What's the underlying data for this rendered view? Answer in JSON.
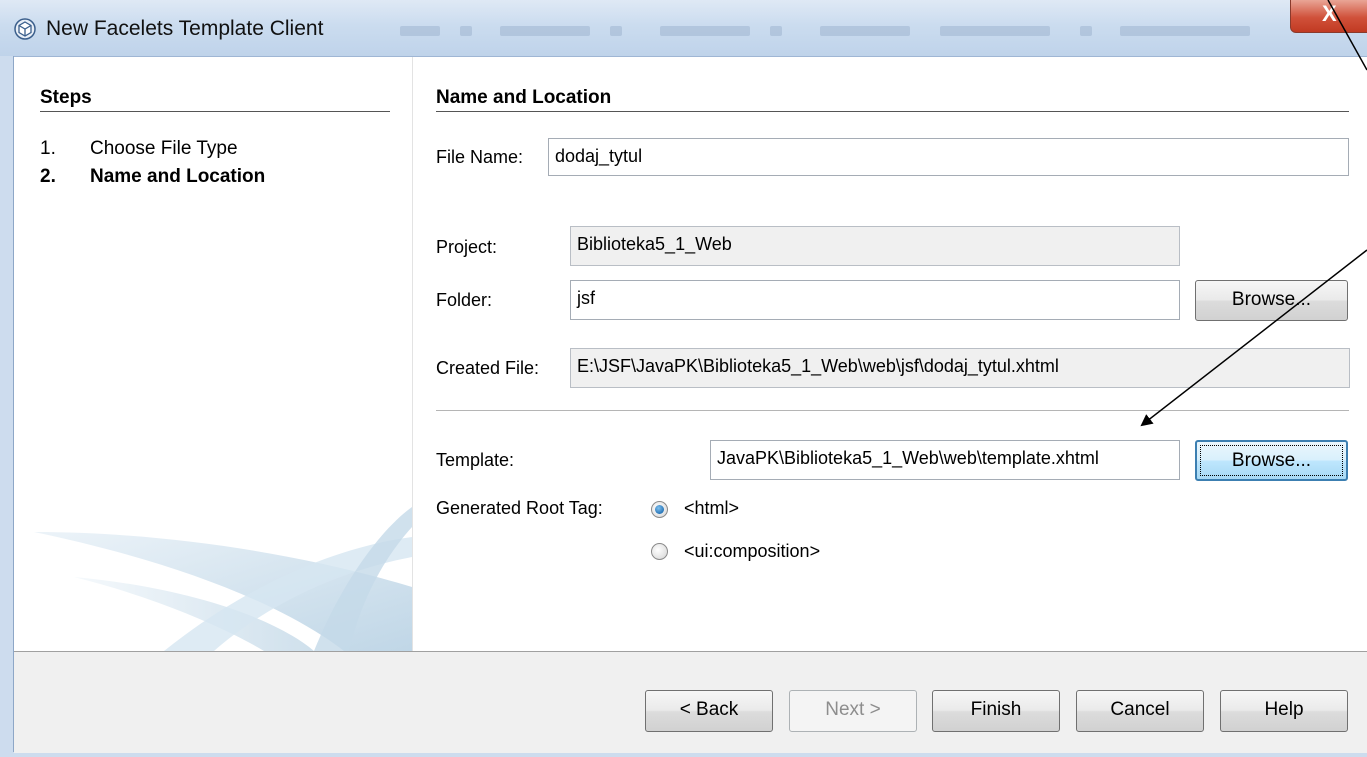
{
  "window": {
    "title": "New Facelets Template Client",
    "close_label": "X"
  },
  "steps": {
    "heading": "Steps",
    "items": [
      {
        "number": "1.",
        "label": "Choose File Type"
      },
      {
        "number": "2.",
        "label": "Name and Location"
      }
    ]
  },
  "form": {
    "heading": "Name and Location",
    "file_name": {
      "label": "File Name:",
      "value": "dodaj_tytul"
    },
    "project": {
      "label": "Project:",
      "value": "Biblioteka5_1_Web"
    },
    "folder": {
      "label": "Folder:",
      "value": "jsf",
      "browse_label": "Browse..."
    },
    "created_file": {
      "label": "Created File:",
      "value": "E:\\JSF\\JavaPK\\Biblioteka5_1_Web\\web\\jsf\\dodaj_tytul.xhtml"
    },
    "template": {
      "label": "Template:",
      "value": "JavaPK\\Biblioteka5_1_Web\\web\\template.xhtml",
      "browse_label": "Browse..."
    },
    "root_tag": {
      "label": "Generated Root Tag:",
      "options": [
        {
          "label": "<html>",
          "selected": true
        },
        {
          "label": "<ui:composition>",
          "selected": false
        }
      ]
    }
  },
  "buttons": {
    "back": "< Back",
    "next": "Next >",
    "finish": "Finish",
    "cancel": "Cancel",
    "help": "Help"
  },
  "colors": {
    "title_bar": "#cbdcef",
    "close": "#c13a22",
    "focus": "#3c7fb1",
    "bottom_bar": "#f0f0f0"
  }
}
